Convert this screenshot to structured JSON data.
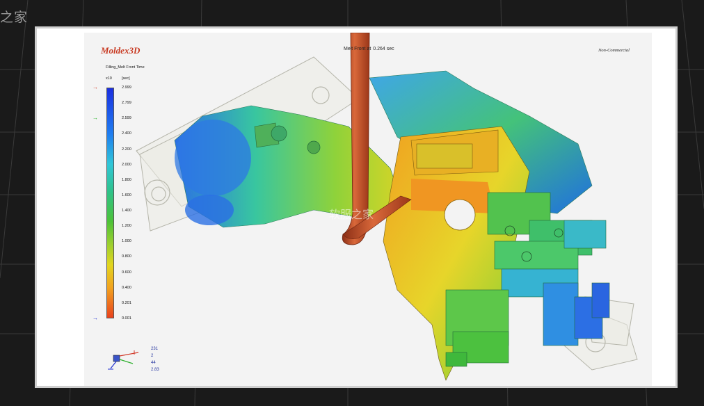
{
  "watermark_corner": "之家",
  "watermark_center": "软服之家",
  "brand": "Moldex3D",
  "header": {
    "melt_label": "Melt Front at",
    "melt_value": "0.264 sec",
    "noncommercial": "Non-Commercial"
  },
  "result": {
    "name": "Filling_Melt Front Time",
    "unit_exp": "x10",
    "unit": "[sec]"
  },
  "legend": {
    "ticks": [
      "2.999",
      "2.799",
      "2.599",
      "2.400",
      "2.200",
      "2.000",
      "1.800",
      "1.600",
      "1.400",
      "1.200",
      "1.000",
      "0.800",
      "0.600",
      "0.400",
      "0.201",
      "0.001"
    ],
    "markers": [
      {
        "color": "#d2321a",
        "at": "2.999"
      },
      {
        "color": "#2fb82f",
        "at": "2.599"
      },
      {
        "color": "#1f2fd0",
        "at": "0.001"
      }
    ]
  },
  "readout": [
    "231",
    "2",
    "44",
    "2.83"
  ],
  "colors": {
    "brand": "#c83a22",
    "scale_top": "#1b2fe0",
    "scale_bottom": "#e8421d",
    "sprue": "#c4532a"
  }
}
